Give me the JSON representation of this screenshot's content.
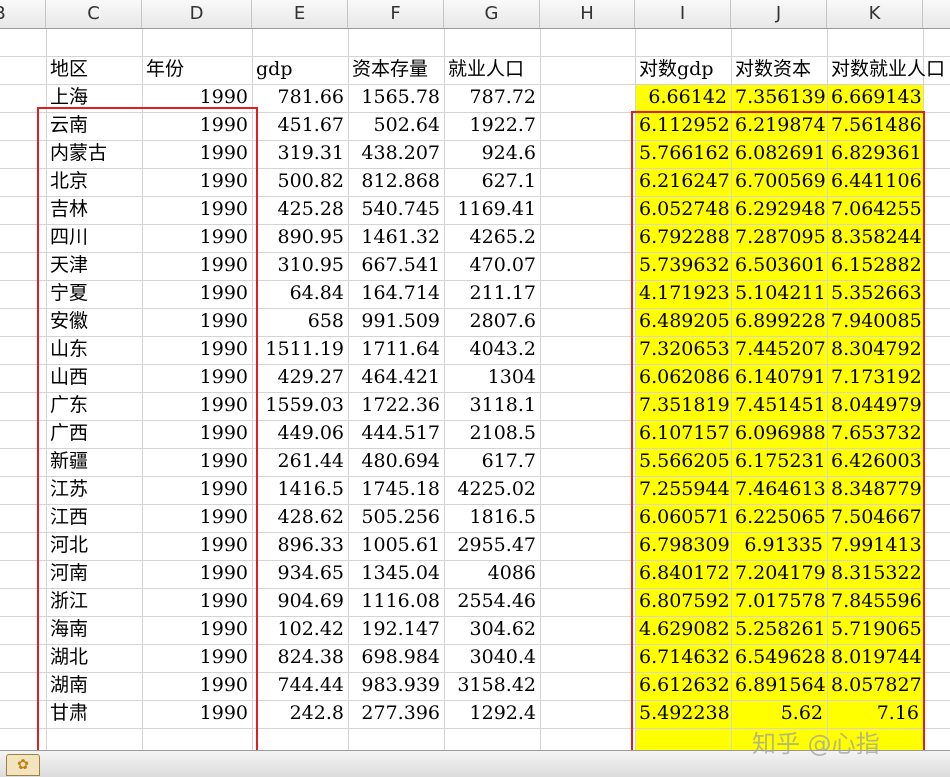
{
  "columns": [
    "B",
    "C",
    "D",
    "E",
    "F",
    "G",
    "H",
    "I",
    "J",
    "K"
  ],
  "headers": [
    "地区",
    "年份",
    "gdp",
    "资本存量",
    "就业人口",
    "",
    "对数gdp",
    "对数资本",
    "对数就业人口"
  ],
  "rows": [
    [
      "上海",
      "1990",
      "781.66",
      "1565.78",
      "787.72",
      "6.66142",
      "7.356139",
      "6.669143"
    ],
    [
      "云南",
      "1990",
      "451.67",
      "502.64",
      "1922.7",
      "6.112952",
      "6.219874",
      "7.561486"
    ],
    [
      "内蒙古",
      "1990",
      "319.31",
      "438.207",
      "924.6",
      "5.766162",
      "6.082691",
      "6.829361"
    ],
    [
      "北京",
      "1990",
      "500.82",
      "812.868",
      "627.1",
      "6.216247",
      "6.700569",
      "6.441106"
    ],
    [
      "吉林",
      "1990",
      "425.28",
      "540.745",
      "1169.41",
      "6.052748",
      "6.292948",
      "7.064255"
    ],
    [
      "四川",
      "1990",
      "890.95",
      "1461.32",
      "4265.2",
      "6.792288",
      "7.287095",
      "8.358244"
    ],
    [
      "天津",
      "1990",
      "310.95",
      "667.541",
      "470.07",
      "5.739632",
      "6.503601",
      "6.152882"
    ],
    [
      "宁夏",
      "1990",
      "64.84",
      "164.714",
      "211.17",
      "4.171923",
      "5.104211",
      "5.352663"
    ],
    [
      "安徽",
      "1990",
      "658",
      "991.509",
      "2807.6",
      "6.489205",
      "6.899228",
      "7.940085"
    ],
    [
      "山东",
      "1990",
      "1511.19",
      "1711.64",
      "4043.2",
      "7.320653",
      "7.445207",
      "8.304792"
    ],
    [
      "山西",
      "1990",
      "429.27",
      "464.421",
      "1304",
      "6.062086",
      "6.140791",
      "7.173192"
    ],
    [
      "广东",
      "1990",
      "1559.03",
      "1722.36",
      "3118.1",
      "7.351819",
      "7.451451",
      "8.044979"
    ],
    [
      "广西",
      "1990",
      "449.06",
      "444.517",
      "2108.5",
      "6.107157",
      "6.096988",
      "7.653732"
    ],
    [
      "新疆",
      "1990",
      "261.44",
      "480.694",
      "617.7",
      "5.566205",
      "6.175231",
      "6.426003"
    ],
    [
      "江苏",
      "1990",
      "1416.5",
      "1745.18",
      "4225.02",
      "7.255944",
      "7.464613",
      "8.348779"
    ],
    [
      "江西",
      "1990",
      "428.62",
      "505.256",
      "1816.5",
      "6.060571",
      "6.225065",
      "7.504667"
    ],
    [
      "河北",
      "1990",
      "896.33",
      "1005.61",
      "2955.47",
      "6.798309",
      "6.91335",
      "7.991413"
    ],
    [
      "河南",
      "1990",
      "934.65",
      "1345.04",
      "4086",
      "6.840172",
      "7.204179",
      "8.315322"
    ],
    [
      "浙江",
      "1990",
      "904.69",
      "1116.08",
      "2554.46",
      "6.807592",
      "7.017578",
      "7.845596"
    ],
    [
      "海南",
      "1990",
      "102.42",
      "192.147",
      "304.62",
      "4.629082",
      "5.258261",
      "5.719065"
    ],
    [
      "湖北",
      "1990",
      "824.38",
      "698.984",
      "3040.4",
      "6.714632",
      "6.549628",
      "8.019744"
    ],
    [
      "湖南",
      "1990",
      "744.44",
      "983.939",
      "3158.42",
      "6.612632",
      "6.891564",
      "8.057827"
    ],
    [
      "甘肃",
      "1990",
      "242.8",
      "277.396",
      "1292.4",
      "5.492238",
      "5.62",
      "7.16"
    ]
  ],
  "watermark": "知乎 @心指",
  "colors": {
    "highlight": "#ffff00",
    "outline": "#dd2020"
  }
}
